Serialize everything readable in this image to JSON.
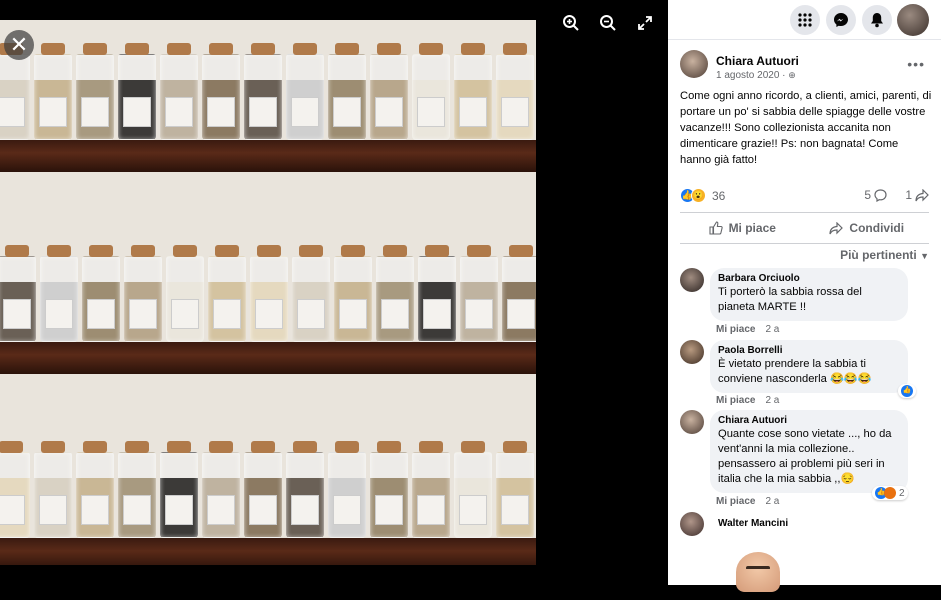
{
  "viewer": {
    "zoom_in_icon": "zoom-in-icon",
    "zoom_out_icon": "zoom-out-icon",
    "fullscreen_icon": "fullscreen-icon",
    "close_icon": "close-icon"
  },
  "topbar": {
    "icons": [
      "grid-menu-icon",
      "messenger-icon",
      "bell-icon",
      "profile-avatar"
    ]
  },
  "post": {
    "author": "Chiara Autuori",
    "date": "1 agosto 2020 · ",
    "privacy_icon": "globe-icon",
    "more_label": "•••",
    "text": "Come ogni anno ricordo, a clienti, amici, parenti, di portare un po' si sabbia delle spiagge delle vostre vacanze!!! Sono collezionista accanita non dimenticare grazie!! Ps: non bagnata! Come hanno già fatto!",
    "reaction_count": "36",
    "comment_count": "5",
    "share_count": "1"
  },
  "actions": {
    "like": "Mi piace",
    "comment": "Condividi"
  },
  "sort_label": "Più pertinenti",
  "comments": [
    {
      "name": "Barbara Orciuolo",
      "text": "Ti porterò la sabbia rossa del pianeta MARTE !!",
      "like": "Mi piace",
      "time": "2 a"
    },
    {
      "name": "Paola Borrelli",
      "text": "È vietato prendere la sabbia ti conviene nasconderla 😂😂😂",
      "like": "Mi piace",
      "time": "2 a"
    },
    {
      "name": "Chiara Autuori",
      "text": "Quante cose sono vietate ..., ho da vent'anni la mia collezione.. pensassero ai problemi più seri in italia che la mia sabbia ,,😔",
      "like": "Mi piace",
      "time": "2 a",
      "react_count": "2"
    },
    {
      "name": "Walter Mancini",
      "text": ""
    }
  ],
  "colors": {
    "like_blue": "#1877f2",
    "shelf": "#4a2214",
    "wall": "#e9e4dc"
  }
}
